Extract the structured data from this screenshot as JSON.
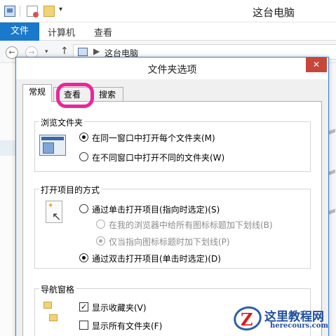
{
  "explorer": {
    "window_title": "这台电脑",
    "ribbon": {
      "file_tab": "文件",
      "tabs": [
        "计算机",
        "查看"
      ]
    },
    "address": {
      "separator": "▶",
      "path": "这台电脑"
    }
  },
  "dialog": {
    "title": "文件夹选项",
    "close_glyph": "✕",
    "tabs": [
      "常规",
      "查看",
      "搜索"
    ],
    "active_tab": "常规",
    "highlight_color": "#e8279a",
    "groups": {
      "browse": {
        "title": "浏览文件夹",
        "options": [
          {
            "label": "在同一窗口中打开每个文件夹(M)",
            "checked": true
          },
          {
            "label": "在不同窗口中打开不同的文件夹(W)",
            "checked": false
          }
        ]
      },
      "click": {
        "title": "打开项目的方式",
        "options": [
          {
            "label": "通过单击打开项目(指向时选定)(S)",
            "checked": false,
            "enabled": true
          },
          {
            "label": "在我的浏览器中给所有图标标题加下划线(B)",
            "checked": false,
            "enabled": false
          },
          {
            "label": "仅当指向图标标题时加下划线(P)",
            "checked": true,
            "enabled": false
          },
          {
            "label": "通过双击打开项目(单击时选定)(D)",
            "checked": true,
            "enabled": true
          }
        ]
      },
      "nav": {
        "title": "导航窗格",
        "options": [
          {
            "label": "显示收藏夹(V)",
            "checked": true
          },
          {
            "label": "显示所有文件夹(F)",
            "checked": false
          }
        ]
      }
    }
  },
  "watermark": {
    "logo_letter": "Z",
    "title": "这里教程网",
    "url": "herecours.com",
    "colors": {
      "blue": "#1f4fa0",
      "red": "#d62020"
    }
  },
  "glyphs": {
    "check": "✓",
    "back": "←",
    "forward": "→",
    "up": "↑",
    "drop": "▾",
    "pointer": "↖",
    "star": "✦"
  }
}
